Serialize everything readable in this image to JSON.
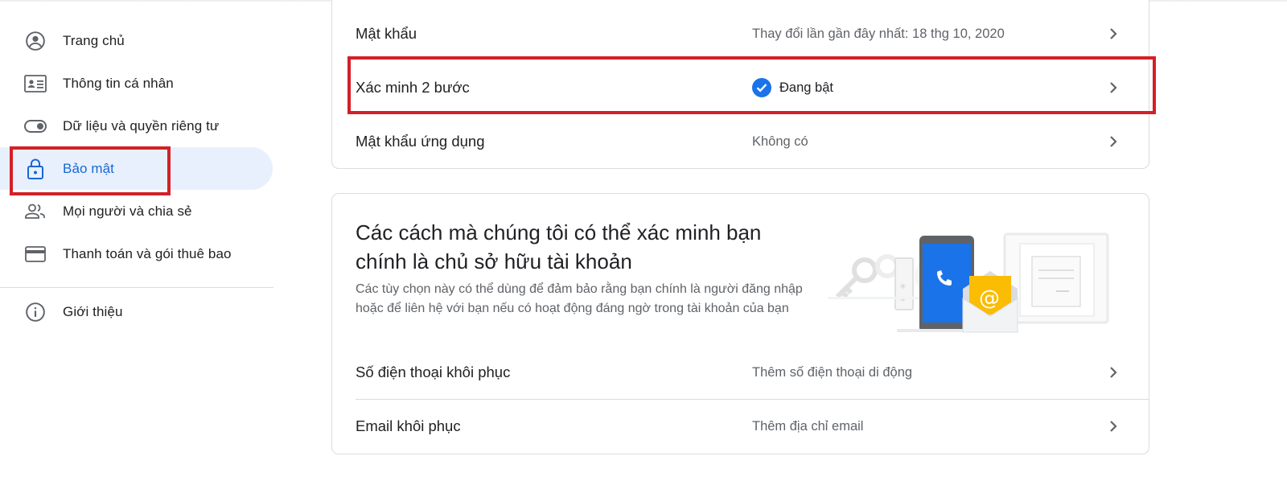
{
  "sidebar": {
    "items": [
      {
        "label": "Trang chủ",
        "icon": "account-circle-icon"
      },
      {
        "label": "Thông tin cá nhân",
        "icon": "id-card-icon"
      },
      {
        "label": "Dữ liệu và quyền riêng tư",
        "icon": "toggle-icon"
      },
      {
        "label": "Bảo mật",
        "icon": "lock-icon",
        "active": true
      },
      {
        "label": "Mọi người và chia sẻ",
        "icon": "people-icon"
      },
      {
        "label": "Thanh toán và gói thuê bao",
        "icon": "credit-card-icon"
      }
    ],
    "about": {
      "label": "Giới thiệu",
      "icon": "info-icon"
    }
  },
  "signin_card": {
    "rows": [
      {
        "label": "Mật khẩu",
        "value": "Thay đổi lần gần đây nhất: 18 thg 10, 2020"
      },
      {
        "label": "Xác minh 2 bước",
        "value": "Đang bật",
        "status": "enabled"
      },
      {
        "label": "Mật khẩu ứng dụng",
        "value": "Không có"
      }
    ]
  },
  "verify_card": {
    "title": "Các cách mà chúng tôi có thể xác minh bạn chính là chủ sở hữu tài khoản",
    "description": "Các tùy chọn này có thể dùng để đảm bảo rằng bạn chính là người đăng nhập hoặc để liên hệ với bạn nếu có hoạt động đáng ngờ trong tài khoản của bạn",
    "rows": [
      {
        "label": "Số điện thoại khôi phục",
        "value": "Thêm số điện thoại di động"
      },
      {
        "label": "Email khôi phục",
        "value": "Thêm địa chỉ email"
      }
    ]
  },
  "colors": {
    "accent": "#1a73e8",
    "active_bg": "#e8f0fe",
    "highlight": "#d32027"
  }
}
